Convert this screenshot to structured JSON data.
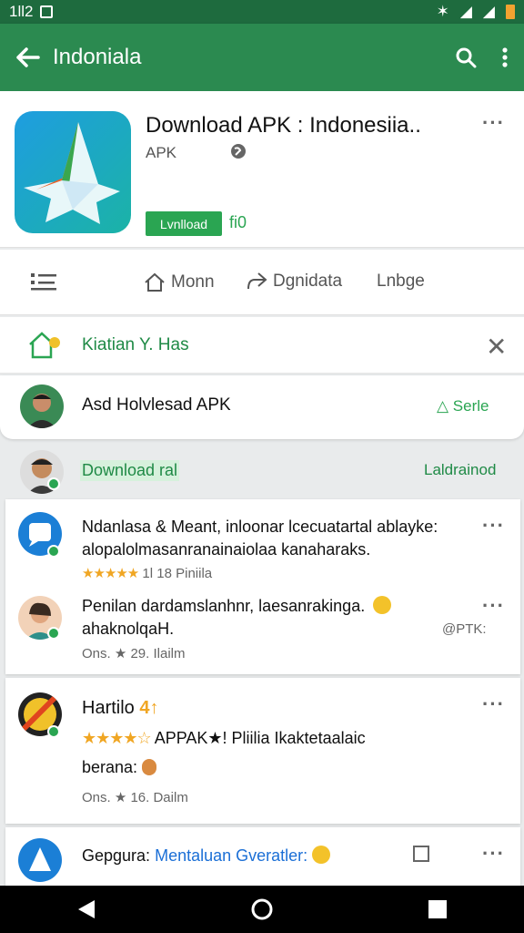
{
  "status": {
    "time": "1ll2"
  },
  "appbar": {
    "title": "Indoniala"
  },
  "app": {
    "title": "Download APK : Indonesiia..",
    "subtitle": "APK",
    "install_label": "Lvnlload",
    "size": "fi0"
  },
  "tabs": {
    "t1": "Monn",
    "t2": "Dgnidata",
    "t3": "Lnbge"
  },
  "notice": {
    "text": "Kiatian Y. Has"
  },
  "promo": {
    "text": "Asd Holvlesad APK",
    "link": "△ Serle"
  },
  "download_row": {
    "chip": "Download ral",
    "right": "Laldrainod"
  },
  "reviews": [
    {
      "line1": "Ndanlasa & Meant, inloonar lcecuatartal ablayke:",
      "line2": "alopalolmasanranainaiolaa kanaharaks.",
      "stars": "★★★★★",
      "meta": "1l  18  Piniila"
    },
    {
      "line1": "Penilan dardamslanhnr, laesanrakinga.",
      "line2": "ahaknolqaH.",
      "handle": "@PTK:",
      "meta": "Ons. ★ 29. Ilailm"
    }
  ],
  "card2": {
    "title": "Hartilo",
    "stars": "★★★★☆",
    "line1": "APPAK★! Pliilia Ikaktetaalaic",
    "line2": "berana:",
    "meta": "Ons. ★ 16. Dailm"
  },
  "card3": {
    "title": "Gepgura:",
    "subtitle": "Mentaluan Gveratler:"
  },
  "colors": {
    "primary": "#2b8a50",
    "accent": "#2aa552",
    "star": "#f0a623"
  }
}
